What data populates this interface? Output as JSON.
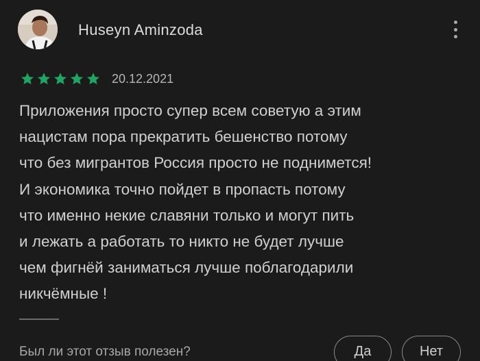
{
  "review": {
    "author": "Huseyn Aminzoda",
    "rating": 5,
    "rating_max": 5,
    "date": "20.12.2021",
    "text_lines": [
      "Приложения просто супер всем советую а этим",
      "нацистам пора прекратить бешенство потому",
      "что без мигрантов Россия просто не поднимется!",
      "И экономика точно пойдет в пропасть потому",
      "что именно некие славяни только и могут пить",
      "и лежать а работать то никто не будет лучше",
      "чем фигнёй заниматься лучше поблагодарили",
      "никчёмные !"
    ]
  },
  "feedback": {
    "question": "Был ли этот отзыв полезен?",
    "yes_label": "Да",
    "no_label": "Нет"
  },
  "colors": {
    "background": "#1c1b1b",
    "star": "#1fa463",
    "text": "#d0d0d0",
    "muted": "#a8a8a8"
  },
  "icons": {
    "more": "more-vert-icon",
    "star": "star-icon"
  }
}
